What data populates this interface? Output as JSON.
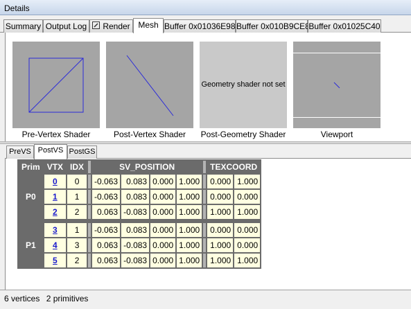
{
  "window": {
    "title": "Details"
  },
  "tabs": [
    {
      "label": "Summary",
      "active": false,
      "icon": ""
    },
    {
      "label": "Output Log",
      "active": false,
      "icon": ""
    },
    {
      "label": "Render",
      "active": false,
      "icon": "pencil-icon"
    },
    {
      "label": "Mesh",
      "active": true,
      "icon": ""
    },
    {
      "label": "Buffer 0x01036E98",
      "active": false,
      "icon": ""
    },
    {
      "label": "Buffer 0x010B9CE8",
      "active": false,
      "icon": ""
    },
    {
      "label": "Buffer 0x01025C40",
      "active": false,
      "icon": ""
    }
  ],
  "previews": [
    {
      "label": "Pre-Vertex Shader",
      "message": ""
    },
    {
      "label": "Post-Vertex Shader",
      "message": ""
    },
    {
      "label": "Post-Geometry Shader",
      "message": "Geometry shader not set"
    },
    {
      "label": "Viewport",
      "message": ""
    }
  ],
  "subtabs": [
    {
      "label": "PreVS",
      "active": false
    },
    {
      "label": "PostVS",
      "active": true
    },
    {
      "label": "PostGS",
      "active": false
    }
  ],
  "grid": {
    "headers": {
      "prim": "Prim",
      "vtx": "VTX",
      "idx": "IDX",
      "position": "SV_POSITION",
      "texcoord": "TEXCOORD"
    },
    "primitives": [
      {
        "label": "P0",
        "rows": [
          {
            "vtx": "0",
            "idx": "0",
            "pos": [
              "-0.063",
              "0.083",
              "0.000",
              "1.000"
            ],
            "tex": [
              "0.000",
              "1.000"
            ]
          },
          {
            "vtx": "1",
            "idx": "1",
            "pos": [
              "-0.063",
              "0.083",
              "0.000",
              "1.000"
            ],
            "tex": [
              "0.000",
              "0.000"
            ]
          },
          {
            "vtx": "2",
            "idx": "2",
            "pos": [
              "0.063",
              "-0.083",
              "0.000",
              "1.000"
            ],
            "tex": [
              "1.000",
              "1.000"
            ]
          }
        ]
      },
      {
        "label": "P1",
        "rows": [
          {
            "vtx": "3",
            "idx": "1",
            "pos": [
              "-0.063",
              "0.083",
              "0.000",
              "1.000"
            ],
            "tex": [
              "0.000",
              "0.000"
            ]
          },
          {
            "vtx": "4",
            "idx": "3",
            "pos": [
              "0.063",
              "-0.083",
              "0.000",
              "1.000"
            ],
            "tex": [
              "1.000",
              "0.000"
            ]
          },
          {
            "vtx": "5",
            "idx": "2",
            "pos": [
              "0.063",
              "-0.083",
              "0.000",
              "1.000"
            ],
            "tex": [
              "1.000",
              "1.000"
            ]
          }
        ]
      }
    ]
  },
  "status": {
    "vertices": "6 vertices",
    "primitives": "2 primitives"
  },
  "colors": {
    "wireframe": "#2b2bd9",
    "header_bg": "#6b6b6b",
    "cell_bg": "#ffffe1",
    "link": "#1a1acc"
  }
}
